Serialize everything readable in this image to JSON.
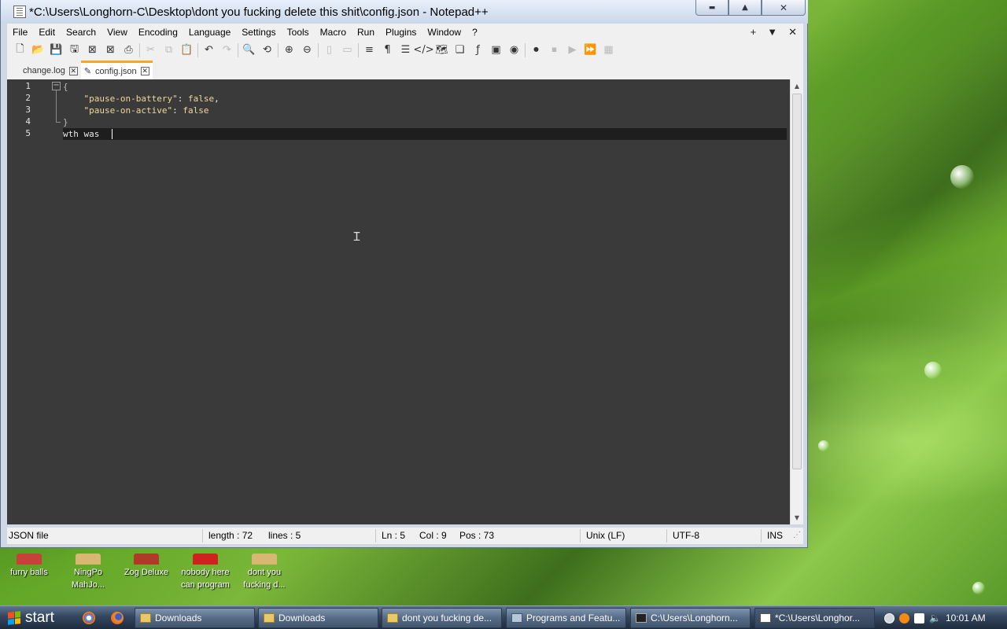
{
  "window": {
    "title": "*C:\\Users\\Longhorn-C\\Desktop\\dont you fucking delete this shit\\config.json - Notepad++",
    "minimize": "▬",
    "maximize": "▲",
    "close": "✕"
  },
  "menu": {
    "items": [
      "File",
      "Edit",
      "Search",
      "View",
      "Encoding",
      "Language",
      "Settings",
      "Tools",
      "Macro",
      "Run",
      "Plugins",
      "Window",
      "?"
    ],
    "right": [
      "+",
      "▼",
      "✕"
    ]
  },
  "tabs": [
    {
      "label": "change.log",
      "close": "✕",
      "active": false
    },
    {
      "label": "config.json",
      "close": "✕",
      "active": true
    }
  ],
  "editor": {
    "line_numbers": [
      "1",
      "2",
      "3",
      "4",
      "5"
    ],
    "lines": [
      {
        "brace": "{"
      },
      {
        "key": "\"pause-on-battery\"",
        "sep": ": ",
        "value": "false",
        "trail": ","
      },
      {
        "key": "\"pause-on-active\"",
        "sep": ": ",
        "value": "false",
        "trail": ""
      },
      {
        "brace": "}"
      },
      {
        "text": "wth was "
      }
    ],
    "current_line": 5
  },
  "statusbar": {
    "file_type": "JSON file",
    "length": "length : 72",
    "lines": "lines : 5",
    "ln": "Ln : 5",
    "col": "Col : 9",
    "pos": "Pos : 73",
    "eol": "Unix (LF)",
    "encoding": "UTF-8",
    "mode": "INS"
  },
  "desktop_icons": [
    {
      "label": "furry balls",
      "color": "#c9403a"
    },
    {
      "label": "NingPo MahJo...",
      "color": "#d8b774"
    },
    {
      "label": "Zog Deluxe",
      "color": "#b03a2a"
    },
    {
      "label": "nobody here can program",
      "color": "#d02020"
    },
    {
      "label": "dont you fucking d...",
      "color": "#d8b774"
    }
  ],
  "taskbar": {
    "start_label": "start",
    "tasks": [
      {
        "label": "Downloads",
        "icon": "folder-icon"
      },
      {
        "label": "Downloads",
        "icon": "folder-icon"
      },
      {
        "label": "dont you fucking de...",
        "icon": "folder-icon"
      },
      {
        "label": "Programs and Featu...",
        "icon": "control-panel-icon"
      },
      {
        "label": "C:\\Users\\Longhorn...",
        "icon": "command-prompt-icon"
      },
      {
        "label": "*C:\\Users\\Longhor...",
        "icon": "notepadpp-icon"
      }
    ],
    "clock": "10:01 AM"
  },
  "colors": {
    "editor_bg": "#3a3a3a",
    "current_line_bg": "#1e1e1e",
    "change_marker": "#f08a22",
    "tab_accent": "#f6a52b"
  }
}
